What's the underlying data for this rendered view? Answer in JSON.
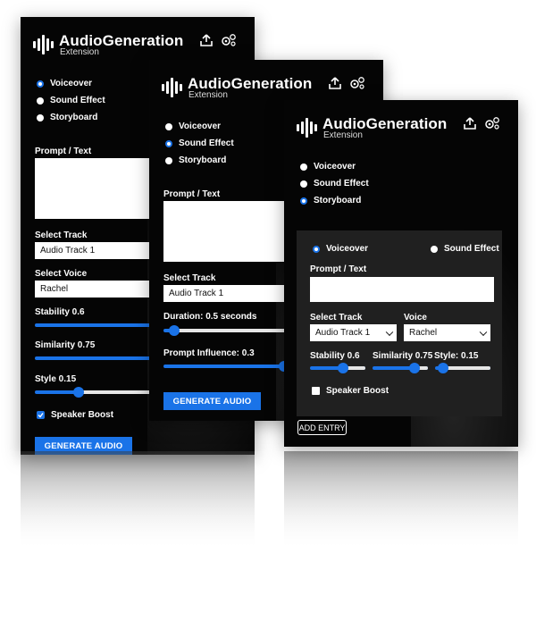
{
  "brand": {
    "name": "AudioGeneration",
    "sub": "Extension"
  },
  "colors": {
    "accent": "#1a73e8",
    "panel_bg": "#050505"
  },
  "modes": [
    "Voiceover",
    "Sound Effect",
    "Storyboard"
  ],
  "panel1": {
    "selected_mode": "Voiceover",
    "prompt_label": "Prompt / Text",
    "track_label": "Select Track",
    "track_value": "Audio Track 1",
    "voice_label": "Select Voice",
    "voice_value": "Rachel",
    "stability_label": "Stability 0.6",
    "stability_value": 0.6,
    "similarity_label": "Similarity 0.75",
    "similarity_value": 0.75,
    "style_label": "Style 0.15",
    "style_value": 0.15,
    "boost_label": "Speaker Boost",
    "generate_label": "GENERATE AUDIO"
  },
  "panel2": {
    "selected_mode": "Sound Effect",
    "prompt_label": "Prompt / Text",
    "track_label": "Select Track",
    "track_value": "Audio Track 1",
    "duration_label": "Duration: 0.5 seconds",
    "duration_value": 0.05,
    "influence_label": "Prompt Influence: 0.3",
    "influence_value": 0.55,
    "generate_label": "GENERATE AUDIO"
  },
  "panel3": {
    "selected_mode": "Storyboard",
    "entry": {
      "mode_voiceover": "Voiceover",
      "mode_sound": "Sound Effect",
      "prompt_label": "Prompt / Text",
      "track_label": "Select Track",
      "track_value": "Audio Track 1",
      "voice_label": "Voice",
      "voice_value": "Rachel",
      "stability_label": "Stability 0.6",
      "stability_value": 0.6,
      "similarity_label": "Similarity 0.75",
      "similarity_value": 0.75,
      "style_label": "Style: 0.15",
      "style_value": 0.15,
      "boost_label": "Speaker Boost"
    },
    "add_entry_label": "ADD ENTRY"
  }
}
